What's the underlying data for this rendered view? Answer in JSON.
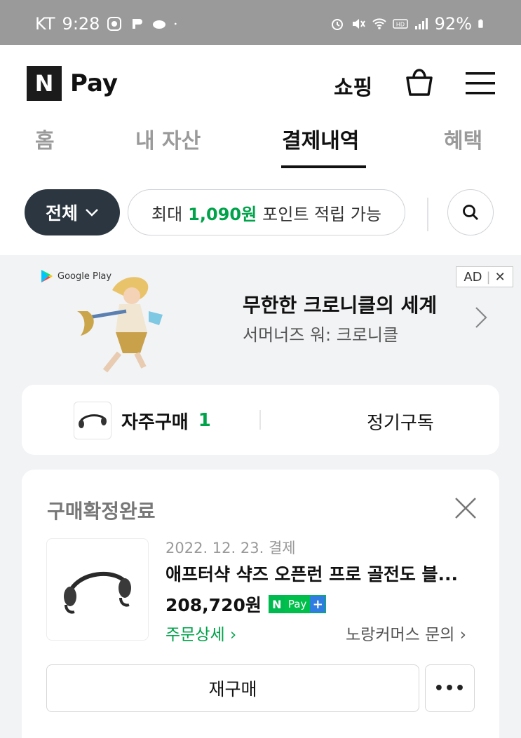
{
  "status_bar": {
    "carrier": "KT",
    "time": "9:28",
    "battery": "92%"
  },
  "header": {
    "logo_letter": "N",
    "logo_text": "Pay",
    "shopping_label": "쇼핑"
  },
  "tabs": [
    {
      "label": "홈"
    },
    {
      "label": "내 자산"
    },
    {
      "label": "결제내역"
    },
    {
      "label": "혜택"
    }
  ],
  "filter": {
    "all_label": "전체",
    "point_prefix": "최대",
    "point_amount": "1,090원",
    "point_suffix": "포인트 적립 가능"
  },
  "ad": {
    "store": "Google Play",
    "title": "무한한 크로니클의 세계",
    "subtitle": "서머너즈 워: 크로니클",
    "badge": "AD",
    "badge_close": "✕"
  },
  "frequent": {
    "label": "자주구매",
    "count": "1",
    "subscribe_label": "정기구독"
  },
  "order": {
    "status": "구매확정완료",
    "date": "2022. 12. 23. 결제",
    "product_name": "애프터샥 샥즈 오픈런 프로 골전도 블...",
    "price": "208,720원",
    "npay_n": "N",
    "npay_pay": "Pay",
    "npay_plus": "+",
    "detail_link": "주문상세 ›",
    "seller_link": "노랑커머스 문의 ›",
    "rebuy_label": "재구매",
    "more_label": "•••"
  },
  "colors": {
    "accent_green": "#00a34a",
    "dark_pill": "#2b3640",
    "status_bar": "#9a9a9a"
  }
}
